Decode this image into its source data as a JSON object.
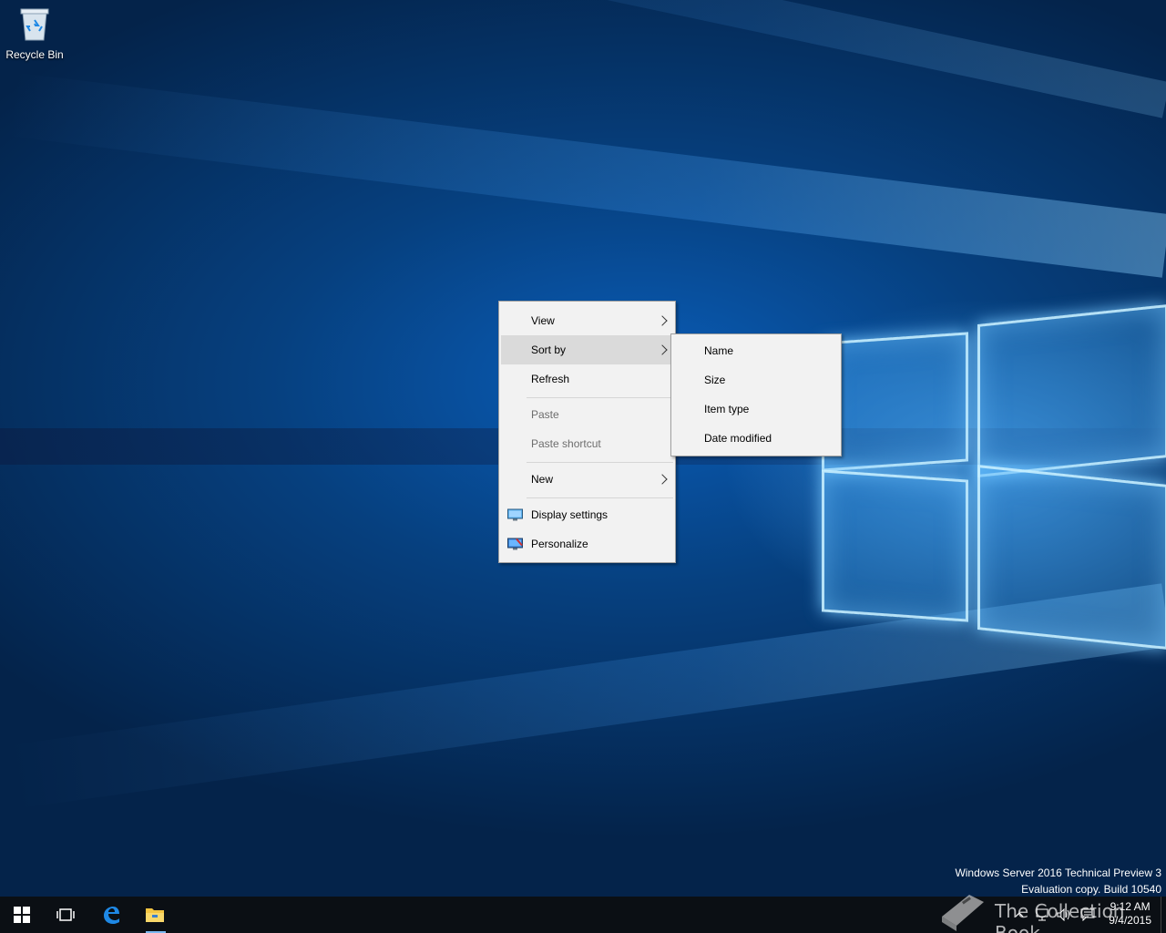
{
  "desktop": {
    "icons": [
      {
        "label": "Recycle Bin",
        "icon": "recycle-bin-icon"
      }
    ]
  },
  "context_menu": {
    "items": [
      {
        "label": "View",
        "submenu": true,
        "enabled": true
      },
      {
        "label": "Sort by",
        "submenu": true,
        "enabled": true,
        "highlighted": true
      },
      {
        "label": "Refresh",
        "enabled": true
      },
      {
        "label": "Paste",
        "enabled": false
      },
      {
        "label": "Paste shortcut",
        "enabled": false
      },
      {
        "label": "New",
        "submenu": true,
        "enabled": true
      },
      {
        "label": "Display settings",
        "icon": "display-settings-icon",
        "enabled": true
      },
      {
        "label": "Personalize",
        "icon": "personalize-icon",
        "enabled": true
      }
    ],
    "sort_by_submenu": [
      {
        "label": "Name"
      },
      {
        "label": "Size"
      },
      {
        "label": "Item type"
      },
      {
        "label": "Date modified"
      }
    ]
  },
  "watermark": {
    "line1": "Windows Server 2016 Technical Preview 3",
    "line2": "Evaluation copy. Build 10540"
  },
  "taskbar": {
    "pinned": [
      {
        "icon": "start-windows-icon"
      },
      {
        "icon": "task-view-icon"
      },
      {
        "icon": "edge-browser-icon"
      },
      {
        "icon": "file-explorer-icon"
      }
    ],
    "tray_icons": [
      "show-hidden-icons-chevron-icon",
      "network-icon",
      "volume-icon",
      "action-center-icon"
    ],
    "clock": {
      "time": "9:12 AM",
      "date": "9/4/2015"
    }
  },
  "overlay_brand": {
    "text": "The Collection Book"
  },
  "colors": {
    "menu_bg": "#f2f2f2",
    "menu_hover": "#dadada",
    "taskbar_bg": "#0b0f14",
    "wallpaper_blue": "#0a5db8"
  }
}
